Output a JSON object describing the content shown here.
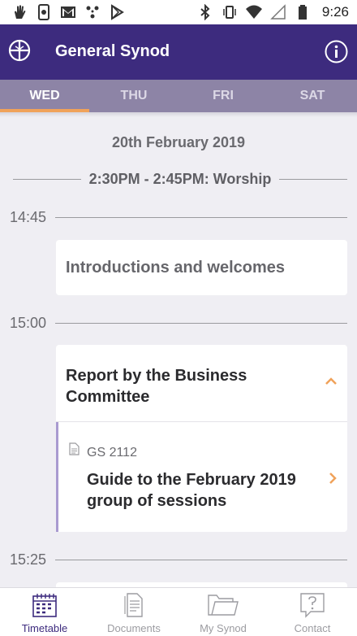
{
  "status_bar": {
    "time": "9:26",
    "left_icons": [
      "hand-icon",
      "screen-record-icon",
      "gmail-icon",
      "nodes-icon",
      "play-store-icon"
    ],
    "right_icons": [
      "bluetooth-icon",
      "vibrate-icon",
      "wifi-icon",
      "signal-icon",
      "battery-icon"
    ]
  },
  "app_bar": {
    "title": "General Synod",
    "logo_icon": "church-cross-icon",
    "info_icon": "info-icon",
    "color": "#3d2b7e"
  },
  "tabs": [
    {
      "label": "WED",
      "active": true
    },
    {
      "label": "THU",
      "active": false
    },
    {
      "label": "FRI",
      "active": false
    },
    {
      "label": "SAT",
      "active": false
    }
  ],
  "schedule": {
    "date": "20th February 2019",
    "worship": "2:30PM - 2:45PM: Worship",
    "times": [
      "14:45",
      "15:00",
      "15:25"
    ],
    "items": [
      {
        "title": "Introductions and welcomes"
      },
      {
        "title": "Report by the Business Committee",
        "expanded": true,
        "documents": [
          {
            "ref": "GS 2112",
            "title": "Guide to the February 2019 group of sessions"
          }
        ]
      }
    ]
  },
  "bottom_nav": [
    {
      "label": "Timetable",
      "icon": "calendar-icon",
      "active": true
    },
    {
      "label": "Documents",
      "icon": "documents-icon",
      "active": false
    },
    {
      "label": "My Synod",
      "icon": "folder-icon",
      "active": false
    },
    {
      "label": "Contact",
      "icon": "help-bubble-icon",
      "active": false
    }
  ],
  "colors": {
    "accent": "#f0a25a",
    "tab_bg": "#8d84a6",
    "doc_accent": "#a99ad0"
  }
}
